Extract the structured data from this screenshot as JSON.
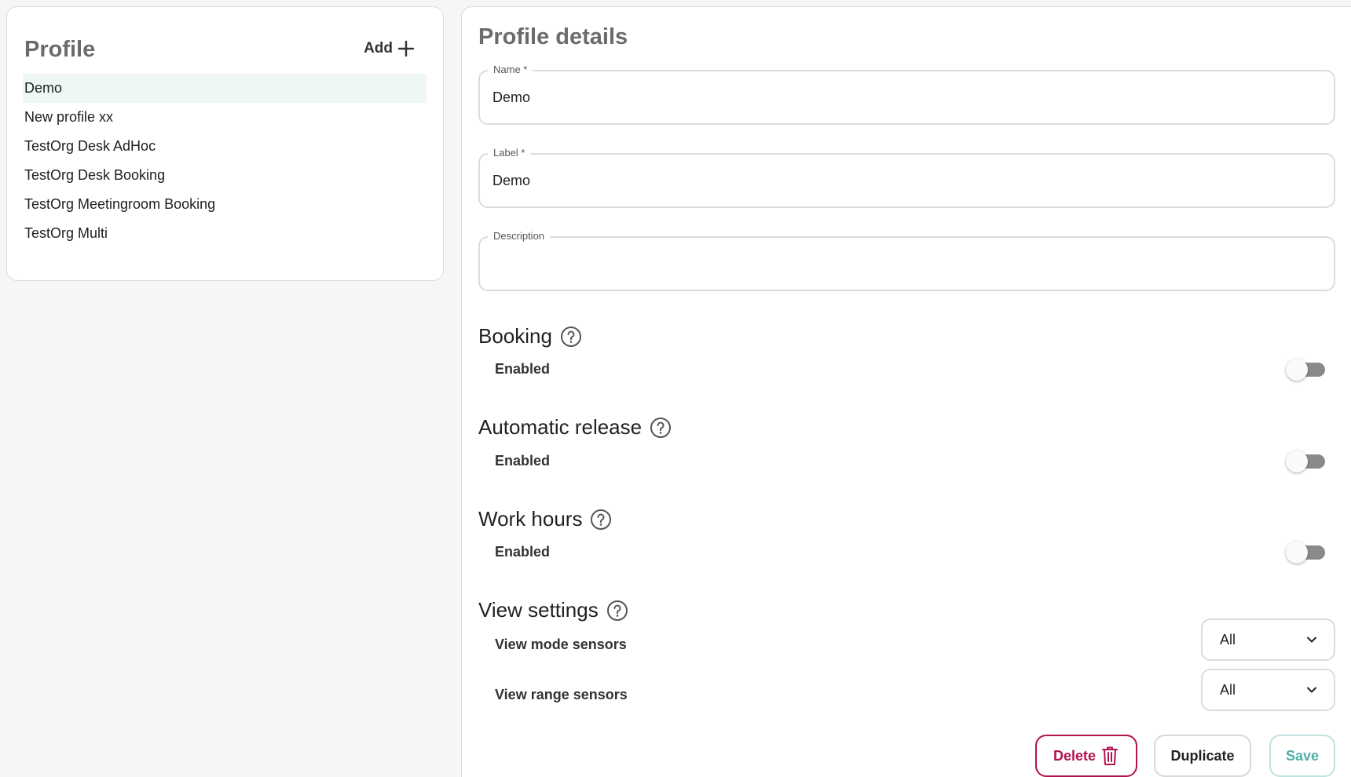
{
  "profile_panel": {
    "title": "Profile",
    "add_label": "Add",
    "items": [
      {
        "label": "Demo",
        "selected": true
      },
      {
        "label": "New profile xx"
      },
      {
        "label": "TestOrg Desk AdHoc"
      },
      {
        "label": "TestOrg Desk Booking"
      },
      {
        "label": "TestOrg Meetingroom Booking"
      },
      {
        "label": "TestOrg Multi"
      }
    ]
  },
  "details": {
    "title": "Profile details",
    "fields": {
      "name": {
        "label": "Name *",
        "value": "Demo"
      },
      "label": {
        "label": "Label *",
        "value": "Demo"
      },
      "description": {
        "label": "Description",
        "value": ""
      }
    },
    "sections": {
      "booking": {
        "title": "Booking",
        "enabled_label": "Enabled",
        "enabled": false
      },
      "automatic_release": {
        "title": "Automatic release",
        "enabled_label": "Enabled",
        "enabled": false
      },
      "work_hours": {
        "title": "Work hours",
        "enabled_label": "Enabled",
        "enabled": false
      },
      "view_settings": {
        "title": "View settings",
        "view_mode_label": "View mode sensors",
        "view_mode_value": "All",
        "view_range_label": "View range sensors",
        "view_range_value": "All"
      }
    },
    "actions": {
      "delete_label": "Delete",
      "duplicate_label": "Duplicate",
      "save_label": "Save"
    }
  },
  "colors": {
    "delete": "#b0134f",
    "save": "#4fb0a8",
    "selected_row": "#eef7f6",
    "toggle_off": "#8a8a8a"
  }
}
